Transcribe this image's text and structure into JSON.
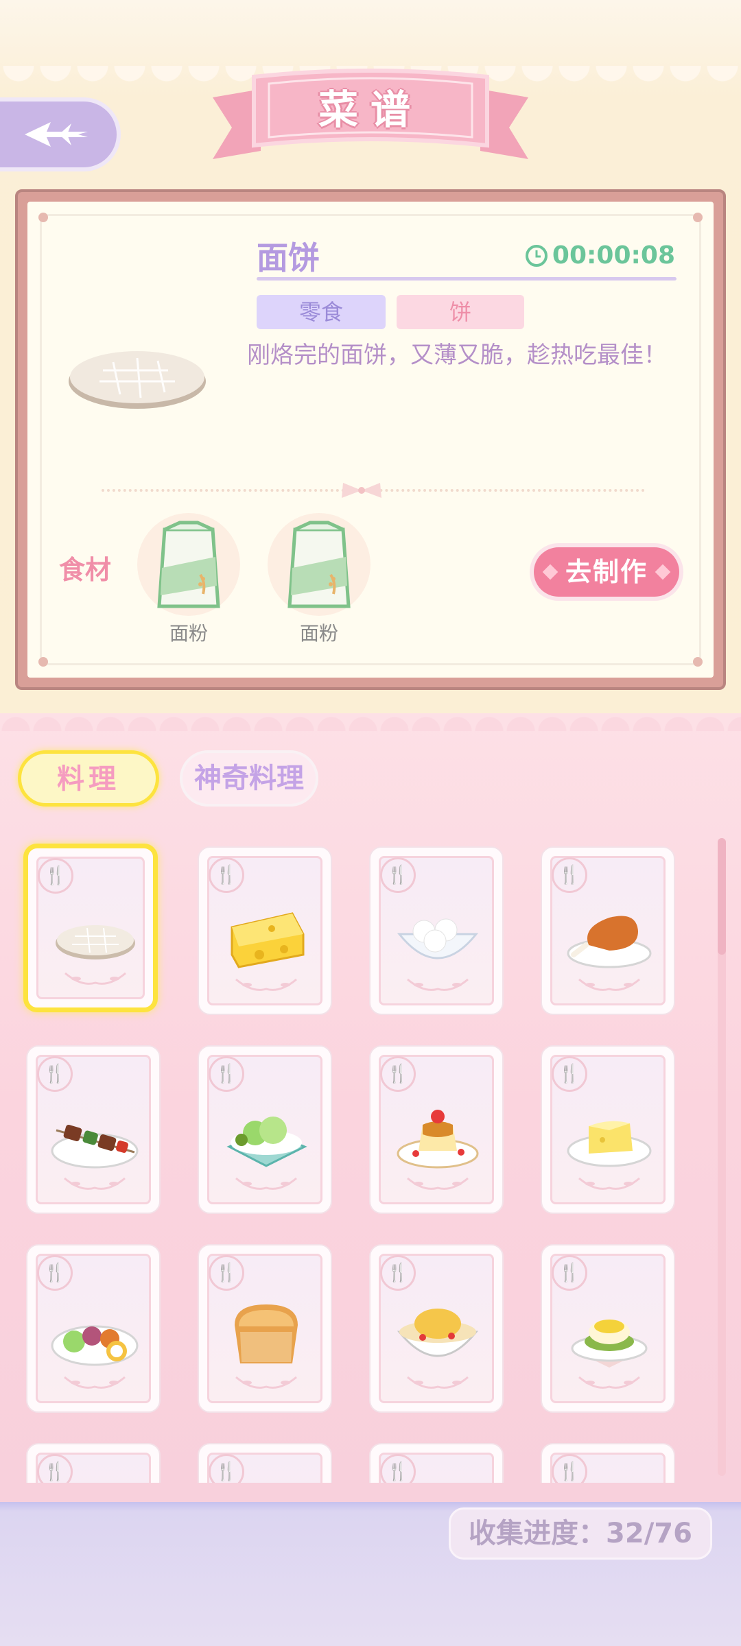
{
  "header": {
    "title": "菜谱",
    "back_icon": "back-arrow-icon"
  },
  "detail": {
    "dish_name": "面饼",
    "timer": "00:00:08",
    "tags": [
      "零食",
      "饼"
    ],
    "description": "刚烙完的面饼，又薄又脆，趁热吃最佳！",
    "ingredients_label": "食材",
    "ingredients": [
      {
        "name": "面粉",
        "icon": "flour-bag-icon"
      },
      {
        "name": "面粉",
        "icon": "flour-bag-icon"
      }
    ],
    "make_button": "去制作"
  },
  "tabs": [
    {
      "label": "料理",
      "active": true
    },
    {
      "label": "神奇料理",
      "active": false
    }
  ],
  "recipes": [
    {
      "icon": "flatbread-icon",
      "selected": true
    },
    {
      "icon": "cheese-icon",
      "selected": false
    },
    {
      "icon": "rice-balls-bowl-icon",
      "selected": false
    },
    {
      "icon": "roast-drumstick-icon",
      "selected": false
    },
    {
      "icon": "kebab-icon",
      "selected": false
    },
    {
      "icon": "salad-icon",
      "selected": false
    },
    {
      "icon": "pudding-icon",
      "selected": false
    },
    {
      "icon": "cheese-omelette-icon",
      "selected": false
    },
    {
      "icon": "mixed-salad-icon",
      "selected": false
    },
    {
      "icon": "bread-loaf-icon",
      "selected": false
    },
    {
      "icon": "chicken-soup-icon",
      "selected": false
    },
    {
      "icon": "eggs-benedict-icon",
      "selected": false
    },
    {
      "icon": "locked-card-icon",
      "selected": false
    },
    {
      "icon": "locked-card-icon",
      "selected": false
    },
    {
      "icon": "locked-card-icon",
      "selected": false
    },
    {
      "icon": "locked-card-icon",
      "selected": false
    }
  ],
  "progress": {
    "text": "收集进度：32/76",
    "collected": 32,
    "total": 76
  },
  "colors": {
    "accent_pink": "#f2819e",
    "accent_purple": "#b49ae0",
    "selected_yellow": "#fde33e",
    "timer_green": "#6bc59a"
  }
}
